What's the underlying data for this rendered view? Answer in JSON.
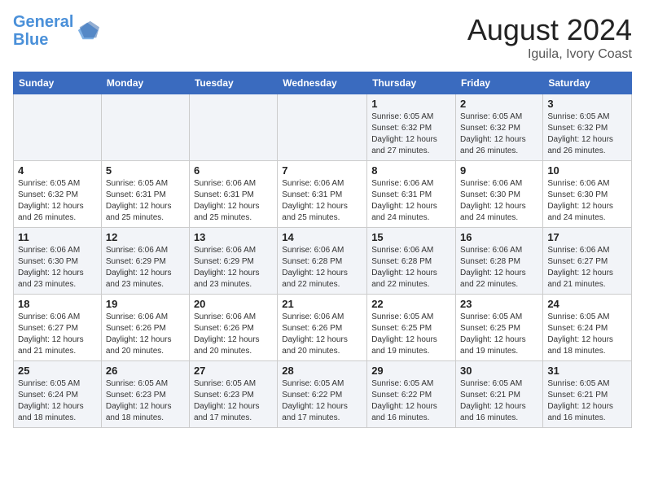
{
  "header": {
    "logo_line1": "General",
    "logo_line2": "Blue",
    "month_year": "August 2024",
    "location": "Iguila, Ivory Coast"
  },
  "days_of_week": [
    "Sunday",
    "Monday",
    "Tuesday",
    "Wednesday",
    "Thursday",
    "Friday",
    "Saturday"
  ],
  "weeks": [
    [
      {
        "day": "",
        "info": ""
      },
      {
        "day": "",
        "info": ""
      },
      {
        "day": "",
        "info": ""
      },
      {
        "day": "",
        "info": ""
      },
      {
        "day": "1",
        "info": "Sunrise: 6:05 AM\nSunset: 6:32 PM\nDaylight: 12 hours and 27 minutes."
      },
      {
        "day": "2",
        "info": "Sunrise: 6:05 AM\nSunset: 6:32 PM\nDaylight: 12 hours and 26 minutes."
      },
      {
        "day": "3",
        "info": "Sunrise: 6:05 AM\nSunset: 6:32 PM\nDaylight: 12 hours and 26 minutes."
      }
    ],
    [
      {
        "day": "4",
        "info": "Sunrise: 6:05 AM\nSunset: 6:32 PM\nDaylight: 12 hours and 26 minutes."
      },
      {
        "day": "5",
        "info": "Sunrise: 6:05 AM\nSunset: 6:31 PM\nDaylight: 12 hours and 25 minutes."
      },
      {
        "day": "6",
        "info": "Sunrise: 6:06 AM\nSunset: 6:31 PM\nDaylight: 12 hours and 25 minutes."
      },
      {
        "day": "7",
        "info": "Sunrise: 6:06 AM\nSunset: 6:31 PM\nDaylight: 12 hours and 25 minutes."
      },
      {
        "day": "8",
        "info": "Sunrise: 6:06 AM\nSunset: 6:31 PM\nDaylight: 12 hours and 24 minutes."
      },
      {
        "day": "9",
        "info": "Sunrise: 6:06 AM\nSunset: 6:30 PM\nDaylight: 12 hours and 24 minutes."
      },
      {
        "day": "10",
        "info": "Sunrise: 6:06 AM\nSunset: 6:30 PM\nDaylight: 12 hours and 24 minutes."
      }
    ],
    [
      {
        "day": "11",
        "info": "Sunrise: 6:06 AM\nSunset: 6:30 PM\nDaylight: 12 hours and 23 minutes."
      },
      {
        "day": "12",
        "info": "Sunrise: 6:06 AM\nSunset: 6:29 PM\nDaylight: 12 hours and 23 minutes."
      },
      {
        "day": "13",
        "info": "Sunrise: 6:06 AM\nSunset: 6:29 PM\nDaylight: 12 hours and 23 minutes."
      },
      {
        "day": "14",
        "info": "Sunrise: 6:06 AM\nSunset: 6:28 PM\nDaylight: 12 hours and 22 minutes."
      },
      {
        "day": "15",
        "info": "Sunrise: 6:06 AM\nSunset: 6:28 PM\nDaylight: 12 hours and 22 minutes."
      },
      {
        "day": "16",
        "info": "Sunrise: 6:06 AM\nSunset: 6:28 PM\nDaylight: 12 hours and 22 minutes."
      },
      {
        "day": "17",
        "info": "Sunrise: 6:06 AM\nSunset: 6:27 PM\nDaylight: 12 hours and 21 minutes."
      }
    ],
    [
      {
        "day": "18",
        "info": "Sunrise: 6:06 AM\nSunset: 6:27 PM\nDaylight: 12 hours and 21 minutes."
      },
      {
        "day": "19",
        "info": "Sunrise: 6:06 AM\nSunset: 6:26 PM\nDaylight: 12 hours and 20 minutes."
      },
      {
        "day": "20",
        "info": "Sunrise: 6:06 AM\nSunset: 6:26 PM\nDaylight: 12 hours and 20 minutes."
      },
      {
        "day": "21",
        "info": "Sunrise: 6:06 AM\nSunset: 6:26 PM\nDaylight: 12 hours and 20 minutes."
      },
      {
        "day": "22",
        "info": "Sunrise: 6:05 AM\nSunset: 6:25 PM\nDaylight: 12 hours and 19 minutes."
      },
      {
        "day": "23",
        "info": "Sunrise: 6:05 AM\nSunset: 6:25 PM\nDaylight: 12 hours and 19 minutes."
      },
      {
        "day": "24",
        "info": "Sunrise: 6:05 AM\nSunset: 6:24 PM\nDaylight: 12 hours and 18 minutes."
      }
    ],
    [
      {
        "day": "25",
        "info": "Sunrise: 6:05 AM\nSunset: 6:24 PM\nDaylight: 12 hours and 18 minutes."
      },
      {
        "day": "26",
        "info": "Sunrise: 6:05 AM\nSunset: 6:23 PM\nDaylight: 12 hours and 18 minutes."
      },
      {
        "day": "27",
        "info": "Sunrise: 6:05 AM\nSunset: 6:23 PM\nDaylight: 12 hours and 17 minutes."
      },
      {
        "day": "28",
        "info": "Sunrise: 6:05 AM\nSunset: 6:22 PM\nDaylight: 12 hours and 17 minutes."
      },
      {
        "day": "29",
        "info": "Sunrise: 6:05 AM\nSunset: 6:22 PM\nDaylight: 12 hours and 16 minutes."
      },
      {
        "day": "30",
        "info": "Sunrise: 6:05 AM\nSunset: 6:21 PM\nDaylight: 12 hours and 16 minutes."
      },
      {
        "day": "31",
        "info": "Sunrise: 6:05 AM\nSunset: 6:21 PM\nDaylight: 12 hours and 16 minutes."
      }
    ]
  ]
}
